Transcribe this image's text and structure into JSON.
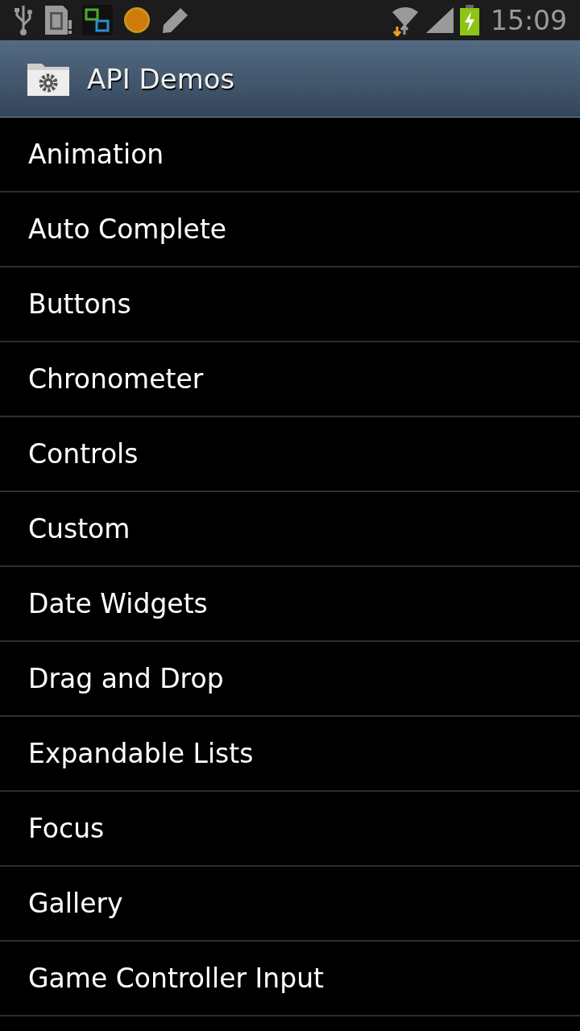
{
  "status_bar": {
    "time": "15:09"
  },
  "app_bar": {
    "title": "API Demos"
  },
  "items": [
    {
      "label": "Animation"
    },
    {
      "label": "Auto Complete"
    },
    {
      "label": "Buttons"
    },
    {
      "label": "Chronometer"
    },
    {
      "label": "Controls"
    },
    {
      "label": "Custom"
    },
    {
      "label": "Date Widgets"
    },
    {
      "label": "Drag and Drop"
    },
    {
      "label": "Expandable Lists"
    },
    {
      "label": "Focus"
    },
    {
      "label": "Gallery"
    },
    {
      "label": "Game Controller Input"
    }
  ]
}
